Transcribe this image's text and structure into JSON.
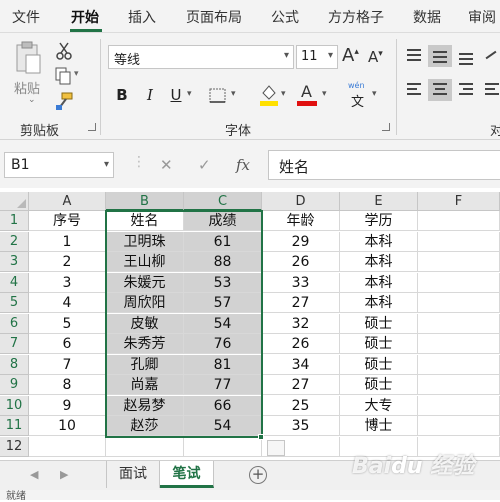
{
  "ribbon_tabs": [
    "文件",
    "开始",
    "插入",
    "页面布局",
    "公式",
    "方方格子",
    "数据",
    "审阅"
  ],
  "active_tab": "开始",
  "clipboard": {
    "paste_label": "粘贴",
    "group_label": "剪贴板"
  },
  "font": {
    "name": "等线",
    "size": "11",
    "group_label": "字体",
    "grow_label": "A",
    "shrink_label": "A",
    "bold": "B",
    "italic": "I",
    "underline": "U",
    "wen_label": "wén",
    "wen_char": "文"
  },
  "alignment": {
    "group_label": "对"
  },
  "formula_bar": {
    "name_box": "B1",
    "cancel": "✕",
    "enter": "✓",
    "fx": "fx",
    "content": "姓名"
  },
  "columns": [
    "A",
    "B",
    "C",
    "D",
    "E",
    "F"
  ],
  "rows": [
    "1",
    "2",
    "3",
    "4",
    "5",
    "6",
    "7",
    "8",
    "9",
    "10",
    "11",
    "12"
  ],
  "table": {
    "header": [
      "序号",
      "姓名",
      "成绩",
      "年龄",
      "学历"
    ],
    "data": [
      [
        "1",
        "卫明珠",
        "61",
        "29",
        "本科"
      ],
      [
        "2",
        "王山柳",
        "88",
        "26",
        "本科"
      ],
      [
        "3",
        "朱媛元",
        "53",
        "33",
        "本科"
      ],
      [
        "4",
        "周欣阳",
        "57",
        "27",
        "本科"
      ],
      [
        "5",
        "皮敏",
        "54",
        "32",
        "硕士"
      ],
      [
        "6",
        "朱秀芳",
        "76",
        "26",
        "硕士"
      ],
      [
        "7",
        "孔卿",
        "81",
        "34",
        "硕士"
      ],
      [
        "8",
        "尚嘉",
        "77",
        "27",
        "硕士"
      ],
      [
        "9",
        "赵易梦",
        "66",
        "25",
        "大专"
      ],
      [
        "10",
        "赵莎",
        "54",
        "35",
        "博士"
      ]
    ]
  },
  "sheets": [
    "面试",
    "笔试"
  ],
  "active_sheet": "笔试",
  "add_sheet": "+",
  "status": "就绪",
  "colors": {
    "accent": "#217346",
    "selection_fill": "#d2d2d2",
    "font_red": "#e01010",
    "highlight_yellow": "#ffe000"
  }
}
